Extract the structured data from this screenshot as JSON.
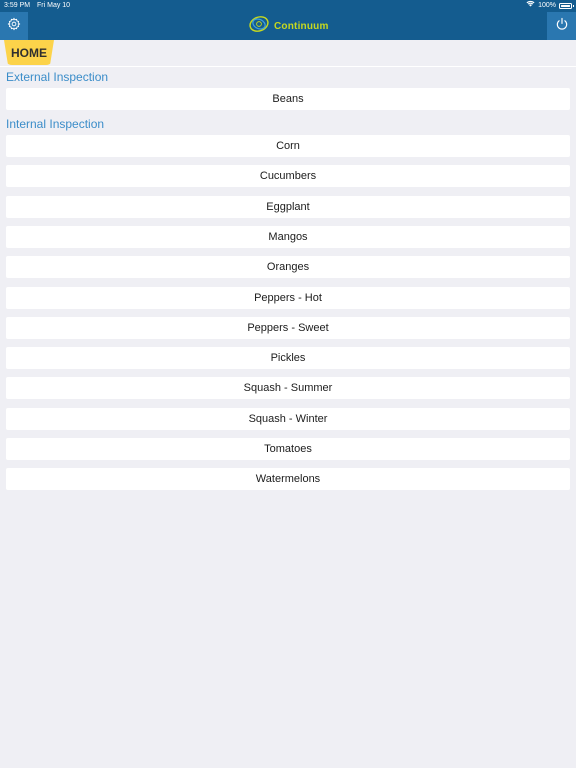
{
  "status_bar": {
    "time": "3:59 PM",
    "date": "Fri May 10",
    "battery": "100%",
    "wifi_icon": "wifi-icon",
    "battery_icon": "battery-icon"
  },
  "nav": {
    "brand_name": "Continuum",
    "settings_icon": "gear-icon",
    "power_icon": "power-icon",
    "logo_icon": "continuum-logo"
  },
  "breadcrumb": {
    "home_label": "HOME"
  },
  "sections": {
    "external": {
      "title": "External Inspection",
      "items": [
        "Beans"
      ]
    },
    "internal": {
      "title": "Internal Inspection",
      "items": [
        "Corn",
        "Cucumbers",
        "Eggplant",
        "Mangos",
        "Oranges",
        "Peppers - Hot",
        "Peppers - Sweet",
        "Pickles",
        "Squash - Summer",
        "Squash - Winter",
        "Tomatoes",
        "Watermelons"
      ]
    }
  },
  "colors": {
    "topbar": "#145c8f",
    "nav_button": "#2a77b0",
    "brand_text": "#c7d91f",
    "home_tab": "#fcd34a",
    "section_header": "#3b8dc9",
    "background": "#efeff4"
  }
}
